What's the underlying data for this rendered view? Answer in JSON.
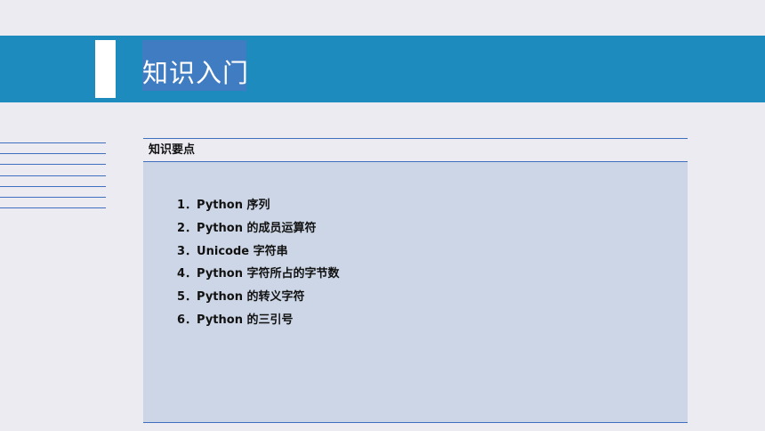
{
  "banner": {
    "title": "知识入门"
  },
  "panel": {
    "header": "知识要点",
    "items": [
      "1．Python 序列",
      "2．Python 的成员运算符",
      "3．Unicode 字符串",
      "4．Python 字符所占的字节数",
      "5．Python 的转义字符",
      "6．Python 的三引号"
    ]
  },
  "colors": {
    "banner": "#1d8bbd",
    "accent": "#3f7cc1",
    "panel_bg": "#cdd6e6",
    "rule": "#3f6fbf"
  }
}
